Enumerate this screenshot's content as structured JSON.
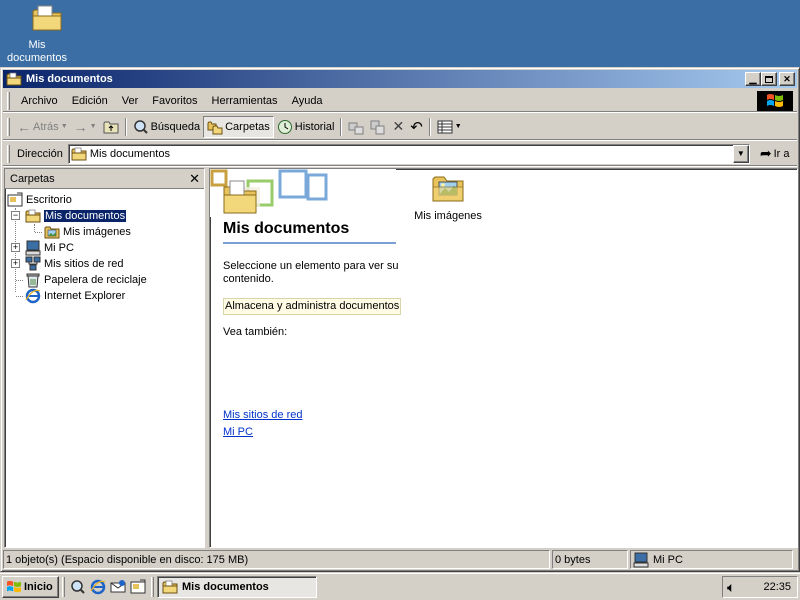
{
  "desktop": {
    "icon_label": "Mis documentos"
  },
  "window": {
    "title": "Mis documentos"
  },
  "menu": [
    "Archivo",
    "Edición",
    "Ver",
    "Favoritos",
    "Herramientas",
    "Ayuda"
  ],
  "toolbar": {
    "back": "Atrás",
    "search": "Búsqueda",
    "folders": "Carpetas",
    "history": "Historial"
  },
  "address": {
    "label": "Dirección",
    "value": "Mis documentos",
    "go": "Ir a"
  },
  "folders_pane": {
    "title": "Carpetas",
    "tree": {
      "desktop": "Escritorio",
      "mydocs": "Mis documentos",
      "mypics": "Mis imágenes",
      "mypc": "Mi PC",
      "network": "Mis sitios de red",
      "recycle": "Papelera de reciclaje",
      "ie": "Internet Explorer"
    }
  },
  "content": {
    "title": "Mis documentos",
    "hint": "Seleccione un elemento para ver su contenido.",
    "info": "Almacena y administra documentos",
    "see_also": "Vea también:",
    "links": [
      "Mis sitios de red",
      "Mi PC"
    ],
    "item_label": "Mis imágenes"
  },
  "status": {
    "objects": "1 objeto(s) (Espacio disponible en disco:  175 MB)",
    "size": "0 bytes",
    "zone": "Mi PC"
  },
  "taskbar": {
    "start": "Inicio",
    "task": "Mis documentos",
    "clock": "22:35"
  },
  "colors": {
    "desktop": "#3a6ea5",
    "title_start": "#0a246a",
    "title_end": "#a6caf0",
    "face": "#d4d0c8",
    "link": "#0033cc"
  }
}
